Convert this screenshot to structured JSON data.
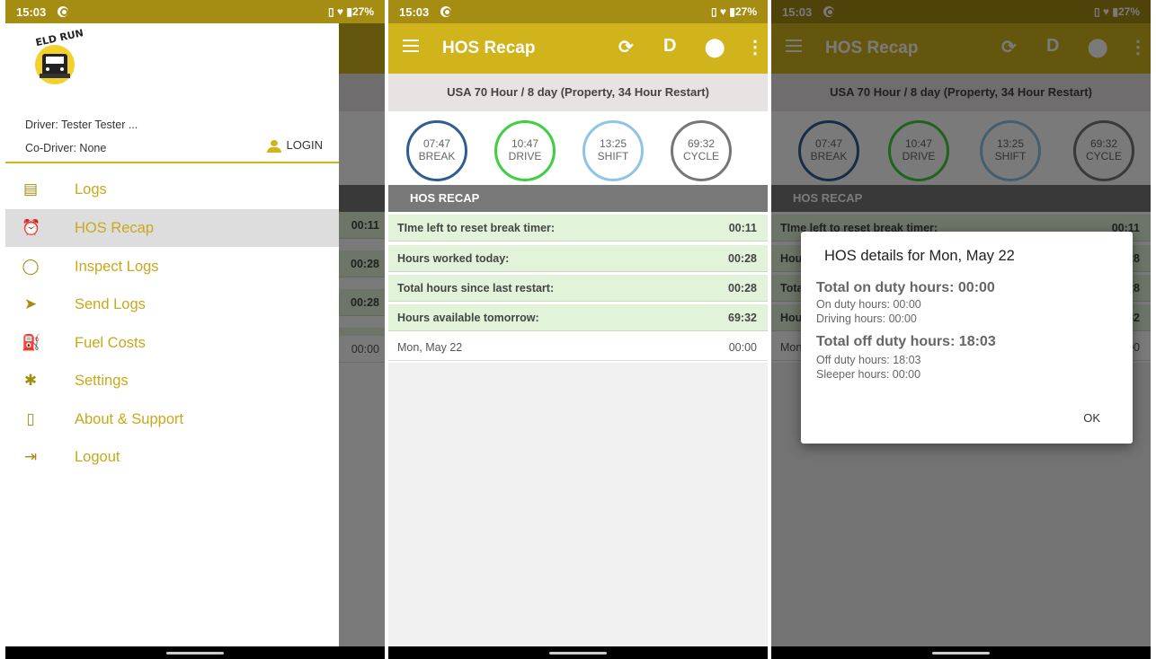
{
  "status": {
    "time": "15:03",
    "battery": "27%"
  },
  "appbar": {
    "title": "HOS Recap",
    "duty_letter": "D"
  },
  "ruleset": "USA 70 Hour / 8 day (Property, 34 Hour Restart)",
  "clocks": [
    {
      "value": "07:47",
      "label": "BREAK",
      "color": "#2f5f8f",
      "fill": 0.85
    },
    {
      "value": "10:47",
      "label": "DRIVE",
      "color": "#3fcf3f",
      "fill": 0.98
    },
    {
      "value": "13:25",
      "label": "SHIFT",
      "color": "#8fc4ea",
      "fill": 0.96
    },
    {
      "value": "69:32",
      "label": "CYCLE",
      "color": "#777777",
      "fill": 0.99
    }
  ],
  "recap": {
    "header": "HOS RECAP",
    "rows": [
      {
        "label": "TIme left to reset break timer:",
        "value": "00:11"
      },
      {
        "label": "Hours worked today:",
        "value": "00:28"
      },
      {
        "label": "Total hours since last restart:",
        "value": "00:28"
      },
      {
        "label": "Hours available tomorrow:",
        "value": "69:32"
      }
    ],
    "day_row": {
      "label": "Mon, May 22",
      "value": "00:00"
    }
  },
  "drawer": {
    "logo_text": "ELD RUN",
    "driver": "Driver: Tester Tester ...",
    "codriver": "Co-Driver: None",
    "login": "LOGIN",
    "items": [
      {
        "label": "Logs",
        "icon": "list-icon"
      },
      {
        "label": "HOS Recap",
        "icon": "alarm-icon"
      },
      {
        "label": "Inspect Logs",
        "icon": "inspect-icon"
      },
      {
        "label": "Send Logs",
        "icon": "send-icon"
      },
      {
        "label": "Fuel Costs",
        "icon": "fuel-icon"
      },
      {
        "label": "Settings",
        "icon": "gear-icon"
      },
      {
        "label": "About & Support",
        "icon": "phone-icon"
      },
      {
        "label": "Logout",
        "icon": "logout-icon"
      }
    ],
    "active_index": 1
  },
  "dialog": {
    "title": "HOS details for Mon, May 22",
    "on_total": "Total on duty hours: 00:00",
    "on_duty": "On duty hours: 00:00",
    "driving": "Driving hours: 00:00",
    "off_total": "Total off duty hours: 18:03",
    "off_duty": "Off duty hours: 18:03",
    "sleeper": "Sleeper hours: 00:00",
    "ok": "OK"
  },
  "colors": {
    "accent": "#d1b31c",
    "statusbar": "#a58d14",
    "row_bg": "#e1f4da"
  }
}
